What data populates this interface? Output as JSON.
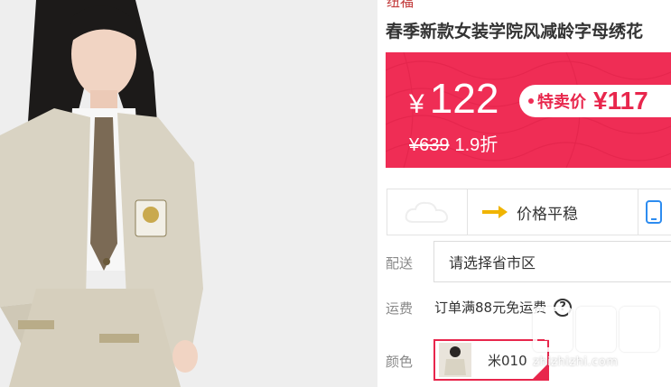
{
  "brand": {
    "partial_text": "纽福"
  },
  "product": {
    "title": "春季新款女装学院风减龄字母绣花"
  },
  "price": {
    "currency": "¥",
    "current": "122",
    "special_label": "特卖价",
    "special_price": "¥117",
    "original": "¥639",
    "discount": "1.9折",
    "box_color": "#ef2d55"
  },
  "info_strip": {
    "cloud_icon": "cloud-icon",
    "price_stable_label": "价格平稳",
    "arrow_icon": "arrow-right-icon",
    "phone_icon": "phone-icon"
  },
  "shipping": {
    "label": "配送",
    "placeholder": "请选择省市区"
  },
  "freight": {
    "label": "运费",
    "text": "订单满88元免运费",
    "help_icon": "question-icon",
    "help_glyph": "?"
  },
  "color": {
    "label": "颜色",
    "selected": "米010"
  },
  "watermark": {
    "text": "zhizhizhi.com",
    "glyph": "值值值"
  }
}
